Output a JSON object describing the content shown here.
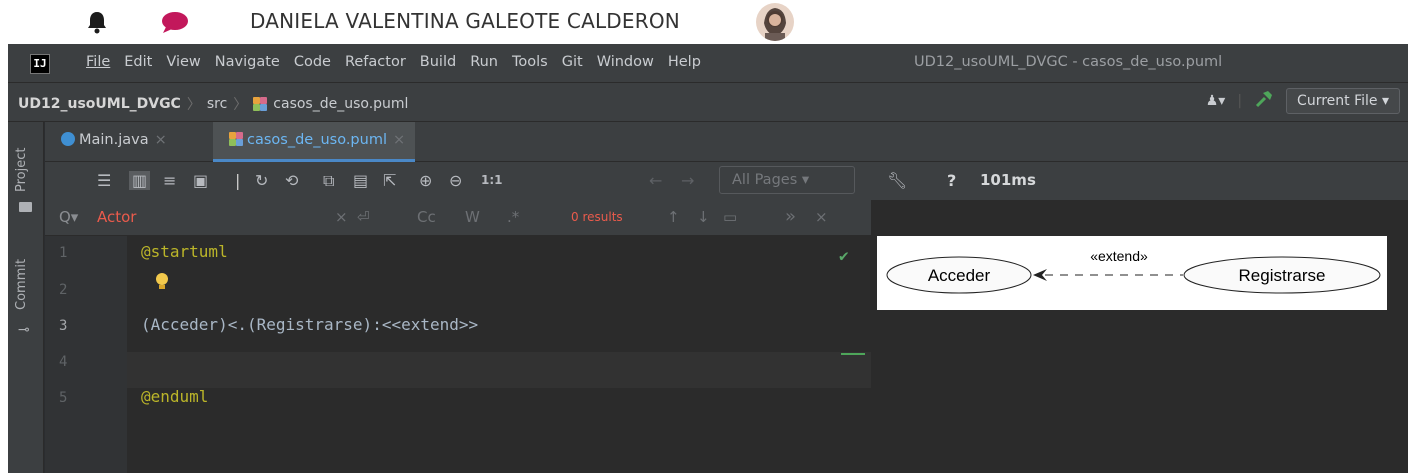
{
  "user_bar": {
    "name": "DANIELA VALENTINA GALEOTE CALDERON"
  },
  "menubar": {
    "items": [
      "File",
      "Edit",
      "View",
      "Navigate",
      "Code",
      "Refactor",
      "Build",
      "Run",
      "Tools",
      "Git",
      "Window",
      "Help"
    ],
    "window_title": "UD12_usoUML_DVGC - casos_de_uso.puml",
    "logo_text": "IJ"
  },
  "navbar": {
    "project": "UD12_usoUML_DVGC",
    "folder": "src",
    "file": "casos_de_uso.puml",
    "run_config": "Current File"
  },
  "sidebar": {
    "project_label": "Project",
    "commit_label": "Commit"
  },
  "tabs": [
    {
      "label": "Main.java",
      "close": "×"
    },
    {
      "label": "casos_de_uso.puml",
      "close": "×"
    }
  ],
  "toolbar": {
    "zoom_label": "1:1",
    "pages_select": "All Pages",
    "help": "?",
    "render_time": "101ms"
  },
  "search": {
    "query": "Actor",
    "case_label": "Cc",
    "word_label": "W",
    "regex_label": ".*",
    "results": "0 results"
  },
  "editor": {
    "line_numbers": [
      "1",
      "2",
      "3",
      "4",
      "5"
    ],
    "lines": [
      "@startuml",
      "",
      "(Acceder)<.(Registrarse):<<extend>>",
      "",
      "@enduml"
    ]
  },
  "diagram": {
    "left_usecase": "Acceder",
    "right_usecase": "Registrarse",
    "relation_label": "«extend»"
  },
  "colors": {
    "ide_background": "#2b2b2b",
    "panel": "#3c3f41",
    "accent_blue": "#4a88c7",
    "annotation": "#bbb529",
    "search_error": "#ea5b4c",
    "check_green": "#59a869"
  }
}
